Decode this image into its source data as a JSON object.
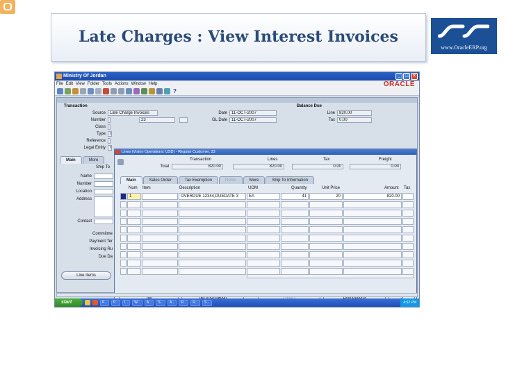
{
  "slide": {
    "title": "Late Charges : View Interest Invoices",
    "logo_url": "www.OracleERP.org"
  },
  "window": {
    "title": "Ministry Of Jordan",
    "brand": "ORACLE",
    "menu": [
      "File",
      "Edit",
      "View",
      "Folder",
      "Tools",
      "Actions",
      "Window",
      "Help"
    ]
  },
  "transaction": {
    "section": "Transaction",
    "source_label": "Source",
    "source": "Late Charge Invoices",
    "date_label": "Date",
    "date": "11-OCT-2007",
    "number_label": "Number",
    "number": "23",
    "gl_date_label": "GL Date",
    "gl_date": "11-OCT-2007",
    "class_label": "Class",
    "type_label": "Type",
    "type": "Ir",
    "reference_label": "Reference",
    "legal_entity_label": "Legal Entity",
    "legal_entity": "V"
  },
  "balance": {
    "section": "Balance Due",
    "line_label": "Line",
    "line": "820.00",
    "tax_label": "Tax",
    "tax": "0.00"
  },
  "left_tabs": [
    "Main",
    "More"
  ],
  "left_fields": {
    "ship_to": "Ship To",
    "name": "Name",
    "number": "Number",
    "location": "Location",
    "address": "Address",
    "contact": "Contact",
    "commitment": "Commitme",
    "payment_terms": "Payment Ter",
    "invoicing_rule": "Invoicing Ru",
    "due_date": "Due Da",
    "line_items_button": "Line Items"
  },
  "lines_window": {
    "title": "Lines (Vision Operations: USD) - Regular Customer, 23",
    "totals_label": "Total",
    "col_transaction": "Transaction",
    "col_lines": "Lines",
    "col_tax": "Tax",
    "col_freight": "Freight",
    "total_transaction": "820.00",
    "total_lines": "820.00",
    "total_tax": "0.00",
    "total_freight": "0.00",
    "tabs": [
      "Main",
      "Sales Order",
      "Tax Exemption",
      "Notes",
      "More",
      "Ship To Information"
    ],
    "grid_headers": [
      "Num",
      "Item",
      "Description",
      "UOM",
      "Quantity",
      "Unit Price",
      "Amount",
      "Tax"
    ],
    "rows": [
      {
        "num": "1",
        "item": "",
        "description": "OVERDUE 12344,DUEDATE 3",
        "uom": "EA",
        "quantity": "41",
        "unit_price": "20",
        "amount": "820.00"
      }
    ],
    "buttons": [
      "Tax",
      "Tax Information",
      "Freight",
      "Distributions",
      "S"
    ]
  },
  "taskbar": {
    "start": "start",
    "items": [
      "P...",
      "P...",
      "I...",
      "W...",
      "A...",
      "S...",
      "A...",
      "R...",
      "R...",
      "S..."
    ],
    "clock": "4:52 PM"
  }
}
